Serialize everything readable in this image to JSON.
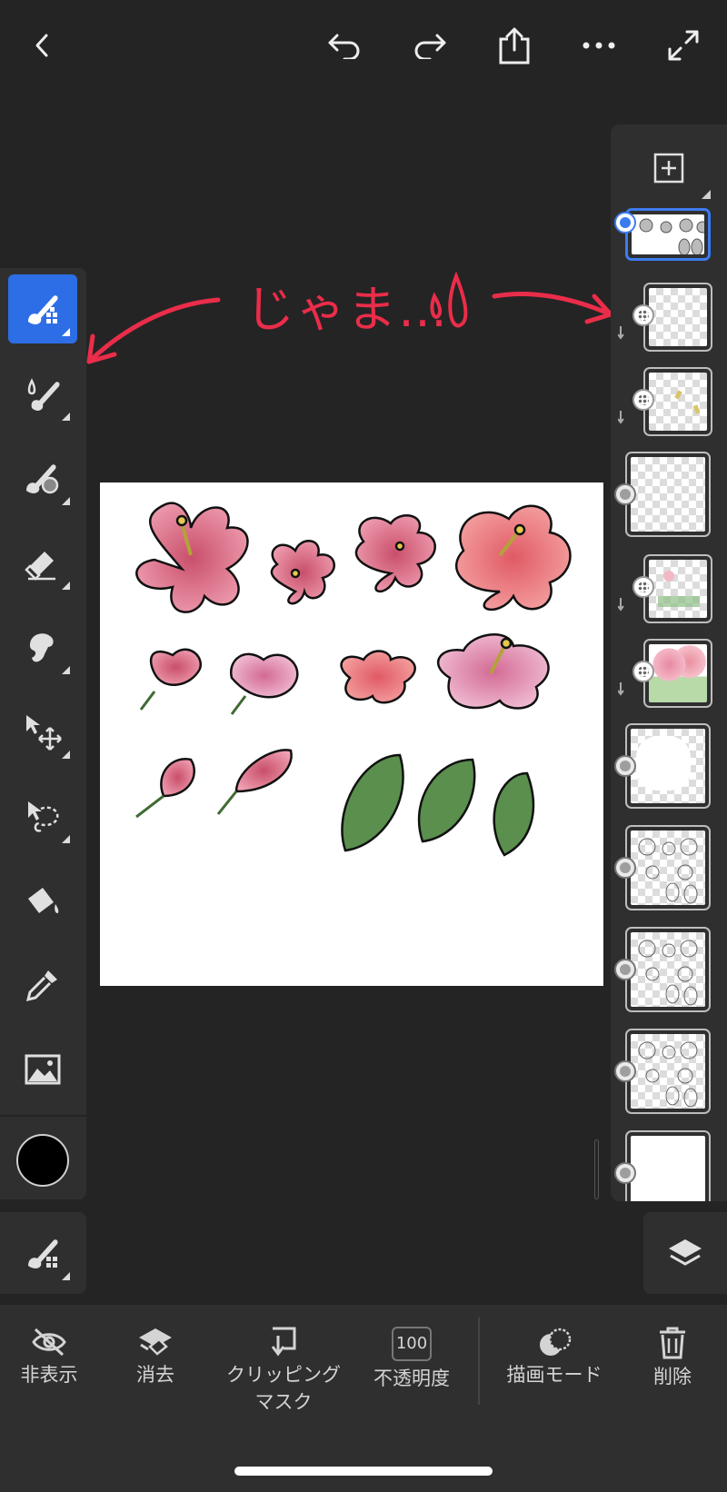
{
  "top_bar": {
    "back_icon": "chevron-left-icon",
    "undo_icon": "undo-icon",
    "redo_icon": "redo-icon",
    "share_icon": "share-icon",
    "more_icon": "more-icon",
    "fullscreen_icon": "expand-icon"
  },
  "annotation": {
    "text": "じゃま…",
    "color": "#ea2d4a"
  },
  "left_toolbar": {
    "tools": [
      {
        "name": "pixel-brush",
        "active": true
      },
      {
        "name": "watercolor-brush"
      },
      {
        "name": "blend-brush"
      },
      {
        "name": "eraser"
      },
      {
        "name": "smudge"
      },
      {
        "name": "transform"
      },
      {
        "name": "lasso-select"
      },
      {
        "name": "fill"
      },
      {
        "name": "eyedropper"
      },
      {
        "name": "image"
      }
    ],
    "color_swatch": "#000000"
  },
  "layers_panel": {
    "add_layer_icon": "plus-square-icon",
    "layers_icon": "layers-icon",
    "accent_color": "#3d7cf0"
  },
  "bottom_bar": {
    "hide_label": "非表示",
    "clear_label": "消去",
    "clipping_label_1": "クリッピング",
    "clipping_label_2": "マスク",
    "opacity_value": "100",
    "opacity_label": "不透明度",
    "blend_mode_label": "描画モード",
    "delete_label": "削除"
  }
}
